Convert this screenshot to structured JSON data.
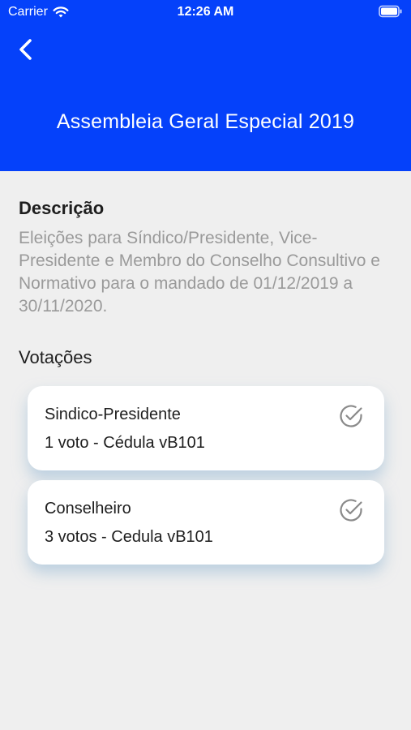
{
  "status_bar": {
    "carrier": "Carrier",
    "time": "12:26 AM"
  },
  "header": {
    "title": "Assembleia Geral Especial 2019",
    "background_color": "#0541fa"
  },
  "description": {
    "label": "Descrição",
    "text": "Eleições para Síndico/Presidente, Vice-Presidente e Membro do Conselho Consultivo e Normativo para o mandado de 01/12/2019 a 30/11/2020."
  },
  "votes": {
    "label": "Votações",
    "items": [
      {
        "name": "Sindico-Presidente",
        "detail": "1 voto - Cédula vB101",
        "icon": "check-circle-icon"
      },
      {
        "name": "Conselheiro",
        "detail": "3 votos - Cedula vB101",
        "icon": "check-circle-icon"
      }
    ]
  }
}
